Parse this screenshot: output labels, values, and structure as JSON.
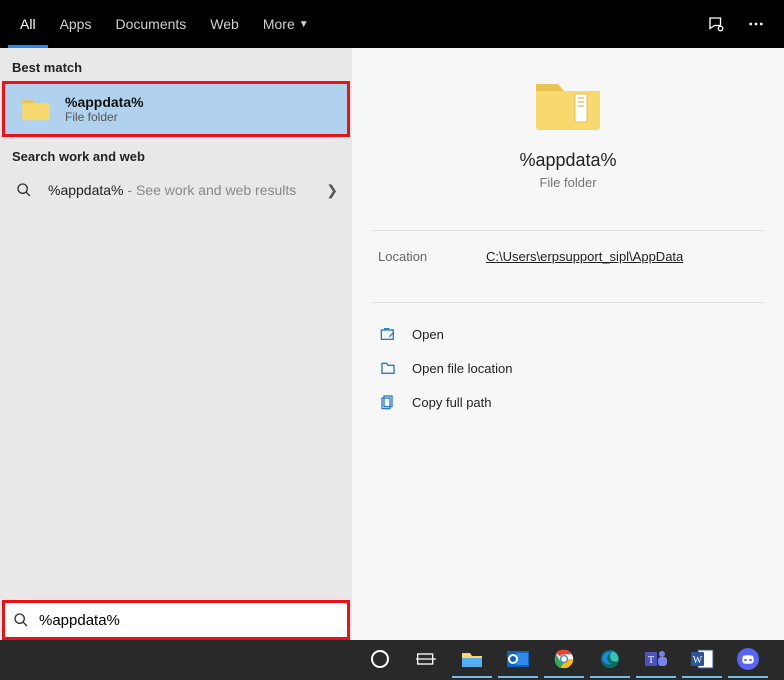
{
  "tabs": {
    "all": "All",
    "apps": "Apps",
    "documents": "Documents",
    "web": "Web",
    "more": "More"
  },
  "sections": {
    "best_match": "Best match",
    "search_work_web": "Search work and web"
  },
  "best_result": {
    "title": "%appdata%",
    "subtitle": "File folder"
  },
  "web_result": {
    "term": "%appdata%",
    "suffix": " - See work and web results"
  },
  "detail": {
    "title": "%appdata%",
    "subtitle": "File folder",
    "location_label": "Location",
    "location_value": "C:\\Users\\erpsupport_sipl\\AppData",
    "open": "Open",
    "open_loc": "Open file location",
    "copy_path": "Copy full path"
  },
  "search_value": "%appdata%"
}
